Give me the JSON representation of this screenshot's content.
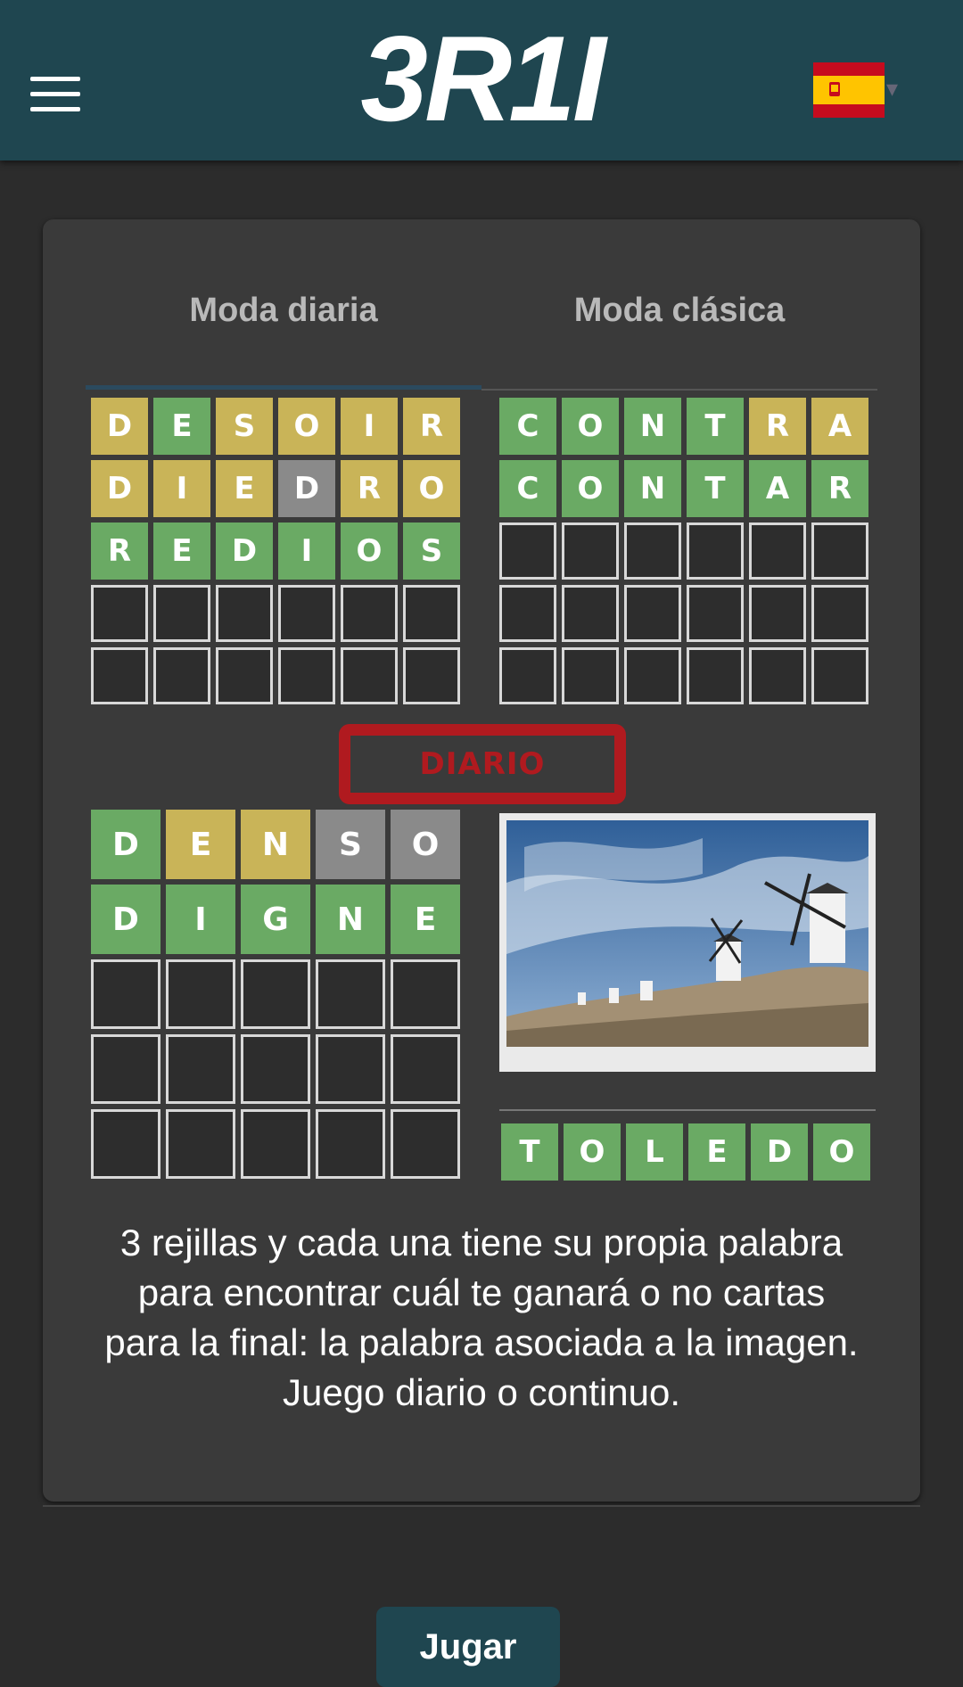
{
  "header": {
    "logo_text": "3R1I",
    "language_flag": "spain-flag",
    "menu_icon": "hamburger-menu-icon"
  },
  "tabs": [
    {
      "label": "Moda diaria",
      "active": true
    },
    {
      "label": "Moda clásica",
      "active": false
    }
  ],
  "colors": {
    "header_bg": "#1f4650",
    "correct": "#6aaa64",
    "present": "#c9b458",
    "absent": "#8a8a8a",
    "stamp_red": "#b01a1f"
  },
  "grids": {
    "daily_six": [
      [
        [
          "D",
          "y"
        ],
        [
          "E",
          "g"
        ],
        [
          "S",
          "y"
        ],
        [
          "O",
          "y"
        ],
        [
          "I",
          "y"
        ],
        [
          "R",
          "y"
        ]
      ],
      [
        [
          "D",
          "y"
        ],
        [
          "I",
          "y"
        ],
        [
          "E",
          "y"
        ],
        [
          "D",
          "x"
        ],
        [
          "R",
          "y"
        ],
        [
          "O",
          "y"
        ]
      ],
      [
        [
          "R",
          "g"
        ],
        [
          "E",
          "g"
        ],
        [
          "D",
          "g"
        ],
        [
          "I",
          "g"
        ],
        [
          "O",
          "g"
        ],
        [
          "S",
          "g"
        ]
      ],
      [
        [
          "",
          "e"
        ],
        [
          "",
          "e"
        ],
        [
          "",
          "e"
        ],
        [
          "",
          "e"
        ],
        [
          "",
          "e"
        ],
        [
          "",
          "e"
        ]
      ],
      [
        [
          "",
          "e"
        ],
        [
          "",
          "e"
        ],
        [
          "",
          "e"
        ],
        [
          "",
          "e"
        ],
        [
          "",
          "e"
        ],
        [
          "",
          "e"
        ]
      ]
    ],
    "classic_six": [
      [
        [
          "C",
          "g"
        ],
        [
          "O",
          "g"
        ],
        [
          "N",
          "g"
        ],
        [
          "T",
          "g"
        ],
        [
          "R",
          "y"
        ],
        [
          "A",
          "y"
        ]
      ],
      [
        [
          "C",
          "g"
        ],
        [
          "O",
          "g"
        ],
        [
          "N",
          "g"
        ],
        [
          "T",
          "g"
        ],
        [
          "A",
          "g"
        ],
        [
          "R",
          "g"
        ]
      ],
      [
        [
          "",
          "e"
        ],
        [
          "",
          "e"
        ],
        [
          "",
          "e"
        ],
        [
          "",
          "e"
        ],
        [
          "",
          "e"
        ],
        [
          "",
          "e"
        ]
      ],
      [
        [
          "",
          "e"
        ],
        [
          "",
          "e"
        ],
        [
          "",
          "e"
        ],
        [
          "",
          "e"
        ],
        [
          "",
          "e"
        ],
        [
          "",
          "e"
        ]
      ],
      [
        [
          "",
          "e"
        ],
        [
          "",
          "e"
        ],
        [
          "",
          "e"
        ],
        [
          "",
          "e"
        ],
        [
          "",
          "e"
        ],
        [
          "",
          "e"
        ]
      ]
    ],
    "five": [
      [
        [
          "D",
          "g"
        ],
        [
          "E",
          "y"
        ],
        [
          "N",
          "y"
        ],
        [
          "S",
          "x"
        ],
        [
          "O",
          "x"
        ]
      ],
      [
        [
          "D",
          "g"
        ],
        [
          "I",
          "g"
        ],
        [
          "G",
          "g"
        ],
        [
          "N",
          "g"
        ],
        [
          "E",
          "g"
        ]
      ],
      [
        [
          "",
          "e"
        ],
        [
          "",
          "e"
        ],
        [
          "",
          "e"
        ],
        [
          "",
          "e"
        ],
        [
          "",
          "e"
        ]
      ],
      [
        [
          "",
          "e"
        ],
        [
          "",
          "e"
        ],
        [
          "",
          "e"
        ],
        [
          "",
          "e"
        ],
        [
          "",
          "e"
        ]
      ],
      [
        [
          "",
          "e"
        ],
        [
          "",
          "e"
        ],
        [
          "",
          "e"
        ],
        [
          "",
          "e"
        ],
        [
          "",
          "e"
        ]
      ]
    ],
    "image_answer": [
      [
        [
          "T",
          "g"
        ],
        [
          "O",
          "g"
        ],
        [
          "L",
          "g"
        ],
        [
          "E",
          "g"
        ],
        [
          "D",
          "g"
        ],
        [
          "O",
          "g"
        ]
      ]
    ]
  },
  "stamp_text": "DIARIO",
  "image": {
    "subject": "windmills-photo"
  },
  "description": "3 rejillas y cada una tiene su propia palabra para encontrar cuál te ganará o no cartas para la final: la palabra asociada a la imagen. Juego diario o continuo.",
  "play_button": "Jugar"
}
